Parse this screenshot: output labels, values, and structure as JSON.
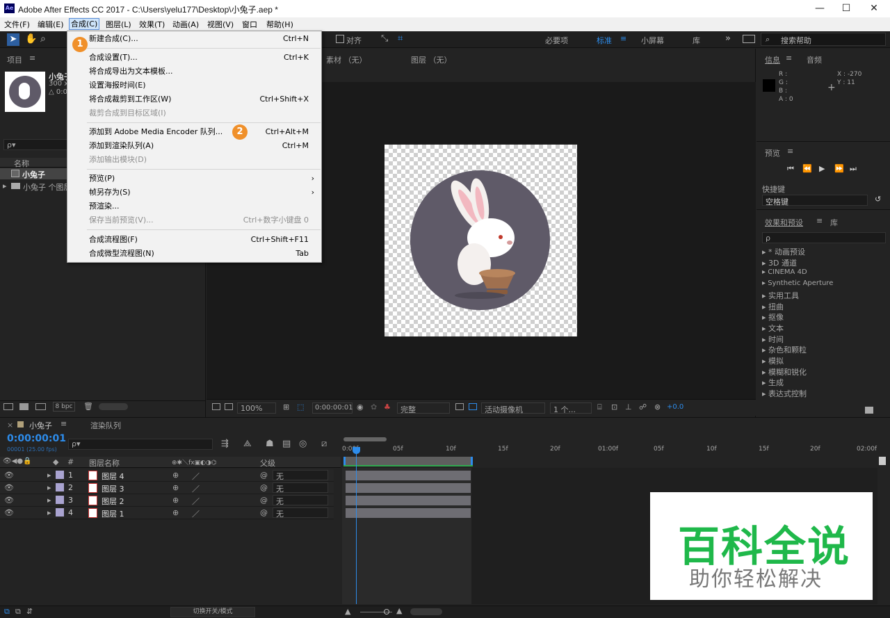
{
  "titlebar": {
    "icon": "Ae",
    "title": "Adobe After Effects CC 2017 - C:\\Users\\yelu177\\Desktop\\小兔子.aep *",
    "min": "—",
    "max": "☐",
    "close": "✕"
  },
  "menubar": [
    "文件(F)",
    "编辑(E)",
    "合成(C)",
    "图层(L)",
    "效果(T)",
    "动画(A)",
    "视图(V)",
    "窗口",
    "帮助(H)"
  ],
  "toolbar": {
    "align": "对齐",
    "workspaces": [
      "必要项",
      "标准",
      "小屏幕",
      "库"
    ],
    "search": "搜索帮助"
  },
  "dropdown": [
    {
      "label": "新建合成(C)...",
      "shortcut": "Ctrl+N",
      "disabled": false
    },
    {
      "label": "合成设置(T)...",
      "shortcut": "Ctrl+K",
      "disabled": false
    },
    {
      "label": "将合成导出为文本模板...",
      "shortcut": "",
      "disabled": false
    },
    {
      "label": "设置海报时间(E)",
      "shortcut": "",
      "disabled": false
    },
    {
      "label": "将合成裁剪到工作区(W)",
      "shortcut": "Ctrl+Shift+X",
      "disabled": false
    },
    {
      "label": "裁剪合成到目标区域(I)",
      "shortcut": "",
      "disabled": true
    },
    {
      "label": "添加到 Adobe Media Encoder 队列...",
      "shortcut": "Ctrl+Alt+M",
      "disabled": false
    },
    {
      "label": "添加到渲染队列(A)",
      "shortcut": "Ctrl+M",
      "disabled": false
    },
    {
      "label": "添加输出模块(D)",
      "shortcut": "",
      "disabled": true
    },
    {
      "label": "预览(P)",
      "shortcut": "›",
      "disabled": false
    },
    {
      "label": "帧另存为(S)",
      "shortcut": "›",
      "disabled": false
    },
    {
      "label": "预渲染...",
      "shortcut": "",
      "disabled": false
    },
    {
      "label": "保存当前预览(V)...",
      "shortcut": "Ctrl+数字小键盘 0",
      "disabled": true
    },
    {
      "label": "合成流程图(F)",
      "shortcut": "Ctrl+Shift+F11",
      "disabled": false
    },
    {
      "label": "合成微型流程图(N)",
      "shortcut": "Tab",
      "disabled": false
    }
  ],
  "badges": [
    "1",
    "2"
  ],
  "project": {
    "title": "项目",
    "item_name": "小兔子",
    "item_dims": "300 x",
    "item_info": "△ 0:0",
    "search": "ρ▾",
    "col_name": "名称",
    "rows": [
      "小兔子",
      "小兔子 个图层"
    ],
    "bpc": "8 bpc"
  },
  "viewer": {
    "tab_footage": "素材 （无）",
    "tab_layer": "图层 （无）",
    "zoom": "100%",
    "time": "0:00:00:01",
    "quality": "完整",
    "camera": "活动摄像机",
    "views": "1 个...",
    "exposure": "+0.0"
  },
  "info": {
    "tab": "信息",
    "tab2": "音频",
    "r": "R :",
    "g": "G :",
    "b": "B :",
    "a": "A : 0",
    "x": "X : -270",
    "y": "Y : 11"
  },
  "preview": {
    "title": "预览",
    "shortcut_label": "快捷键",
    "shortcut_value": "空格键"
  },
  "effects": {
    "tab": "效果和预设",
    "tab2": "库",
    "items": [
      "* 动画预设",
      "3D 通道",
      "CINEMA 4D",
      "Synthetic Aperture",
      "实用工具",
      "扭曲",
      "抠像",
      "文本",
      "时间",
      "杂色和颗粒",
      "模拟",
      "模糊和锐化",
      "生成",
      "表达式控制"
    ]
  },
  "timeline": {
    "tab": "小兔子",
    "tab2": "渲染队列",
    "timecode": "0:00:00:01",
    "fps": "00001 (25.00 fps)",
    "col_layer": "图层名称",
    "col_parent": "父级",
    "layers": [
      {
        "num": "1",
        "name": "图层 4",
        "parent": "无"
      },
      {
        "num": "2",
        "name": "图层 3",
        "parent": "无"
      },
      {
        "num": "3",
        "name": "图层 2",
        "parent": "无"
      },
      {
        "num": "4",
        "name": "图层 1",
        "parent": "无"
      }
    ],
    "ruler": [
      "0:00f",
      "05f",
      "10f",
      "15f",
      "20f",
      "01:00f",
      "05f",
      "10f",
      "15f",
      "20f",
      "02:00f"
    ],
    "footer": "切换开关/模式"
  },
  "watermark": {
    "big": "百科全说",
    "small": "助你轻松解决"
  },
  "colors": {
    "accent": "#2d8ceb",
    "badge": "#f0902a",
    "watermark_green": "#1fb84a",
    "disk": "#5f5a68"
  }
}
